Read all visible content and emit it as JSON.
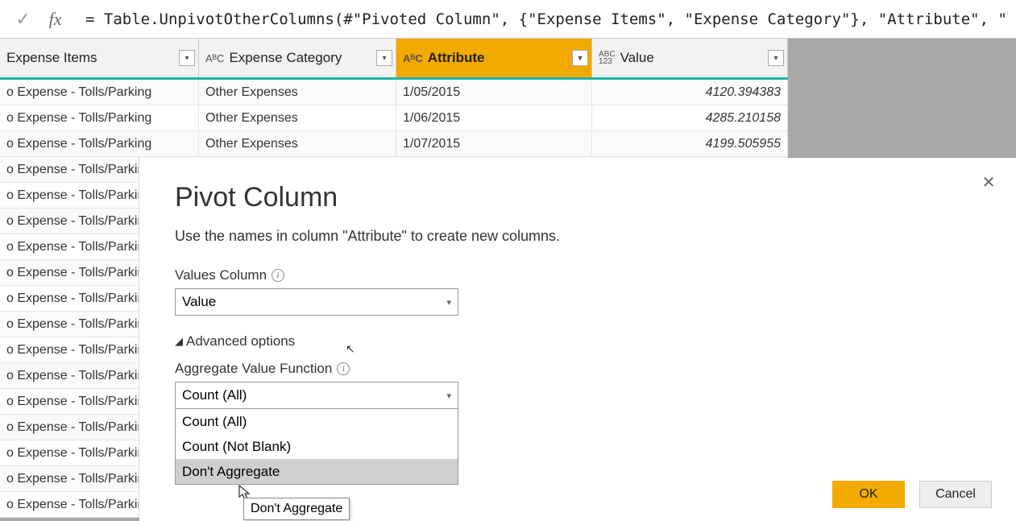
{
  "formula_bar": {
    "fx": "fx",
    "value": "= Table.UnpivotOtherColumns(#\"Pivoted Column\", {\"Expense Items\", \"Expense Category\"}, \"Attribute\", \"Value\")"
  },
  "columns": {
    "c1": "Expense Items",
    "c2": "Expense Category",
    "c3": "Attribute",
    "c4": "Value",
    "type_abc": "AᴮC",
    "type_abc123": "ABC\n123"
  },
  "rows_full": [
    {
      "c1": "o Expense - Tolls/Parking",
      "c2": "Other Expenses",
      "c3": "1/05/2015",
      "c4": "4120.394383"
    },
    {
      "c1": "o Expense - Tolls/Parking",
      "c2": "Other Expenses",
      "c3": "1/06/2015",
      "c4": "4285.210158"
    },
    {
      "c1": "o Expense - Tolls/Parking",
      "c2": "Other Expenses",
      "c3": "1/07/2015",
      "c4": "4199.505955"
    }
  ],
  "rows_partial": [
    "o Expense - Tolls/Parkin",
    "o Expense - Tolls/Parkin",
    "o Expense - Tolls/Parkin",
    "o Expense - Tolls/Parkin",
    "o Expense - Tolls/Parkin",
    "o Expense - Tolls/Parkin",
    "o Expense - Tolls/Parkin",
    "o Expense - Tolls/Parkin",
    "o Expense - Tolls/Parkin",
    "o Expense - Tolls/Parkin",
    "o Expense - Tolls/Parkin",
    "o Expense - Tolls/Parkin",
    "o Expense - Tolls/Parkin",
    "o Expense - Tolls/Parkin"
  ],
  "dialog": {
    "title": "Pivot Column",
    "description": "Use the names in column \"Attribute\" to create new columns.",
    "values_label": "Values Column",
    "values_selected": "Value",
    "advanced_label": "Advanced options",
    "agg_label": "Aggregate Value Function",
    "agg_selected": "Count (All)",
    "options": {
      "o1": "Count (All)",
      "o2": "Count (Not Blank)",
      "o3": "Don't Aggregate"
    },
    "tooltip": "Don't Aggregate",
    "ok": "OK",
    "cancel": "Cancel"
  }
}
